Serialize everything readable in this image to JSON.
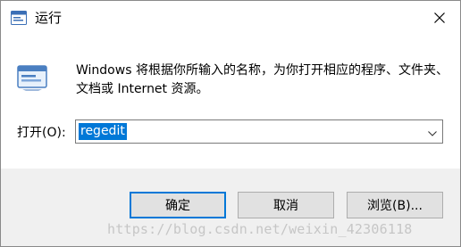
{
  "window": {
    "title": "运行",
    "close_icon": "close-icon"
  },
  "content": {
    "description": "Windows 将根据你所输入的名称，为你打开相应的程序、文件夹、文档或 Internet 资源。",
    "open_label": "打开(O):",
    "input_value": "regedit"
  },
  "buttons": {
    "ok": "确定",
    "cancel": "取消",
    "browse": "浏览(B)..."
  },
  "watermark": "https://blog.csdn.net/weixin_42306118",
  "colors": {
    "selection": "#0078d7",
    "footer_bg": "#f0f0f0",
    "button_bg": "#e1e1e1",
    "default_border": "#0078d7"
  }
}
